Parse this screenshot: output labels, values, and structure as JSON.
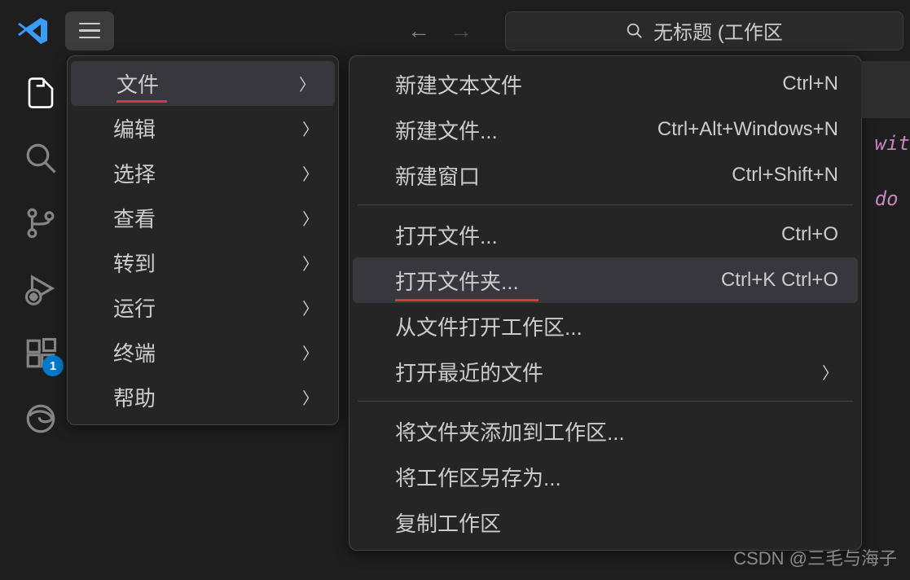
{
  "titlebar": {
    "search_placeholder": "无标题 (工作区"
  },
  "activity": {
    "badge_count": "1"
  },
  "main_menu": {
    "items": [
      {
        "label": "文件",
        "has_submenu": true,
        "highlighted": true,
        "underlined": true
      },
      {
        "label": "编辑",
        "has_submenu": true
      },
      {
        "label": "选择",
        "has_submenu": true
      },
      {
        "label": "查看",
        "has_submenu": true
      },
      {
        "label": "转到",
        "has_submenu": true
      },
      {
        "label": "运行",
        "has_submenu": true
      },
      {
        "label": "终端",
        "has_submenu": true
      },
      {
        "label": "帮助",
        "has_submenu": true
      }
    ]
  },
  "sub_menu": {
    "groups": [
      {
        "items": [
          {
            "label": "新建文本文件",
            "shortcut": "Ctrl+N"
          },
          {
            "label": "新建文件...",
            "shortcut": "Ctrl+Alt+Windows+N"
          },
          {
            "label": "新建窗口",
            "shortcut": "Ctrl+Shift+N"
          }
        ]
      },
      {
        "items": [
          {
            "label": "打开文件...",
            "shortcut": "Ctrl+O"
          },
          {
            "label": "打开文件夹...",
            "shortcut": "Ctrl+K Ctrl+O",
            "highlighted": true,
            "underlined": true
          },
          {
            "label": "从文件打开工作区...",
            "shortcut": ""
          },
          {
            "label": "打开最近的文件",
            "has_submenu": true
          }
        ]
      },
      {
        "items": [
          {
            "label": "将文件夹添加到工作区...",
            "shortcut": ""
          },
          {
            "label": "将工作区另存为...",
            "shortcut": ""
          },
          {
            "label": "复制工作区",
            "shortcut": ""
          }
        ]
      }
    ]
  },
  "editor": {
    "keyword1": "wit",
    "keyword2": "do"
  },
  "watermark": "CSDN @三毛与海子"
}
